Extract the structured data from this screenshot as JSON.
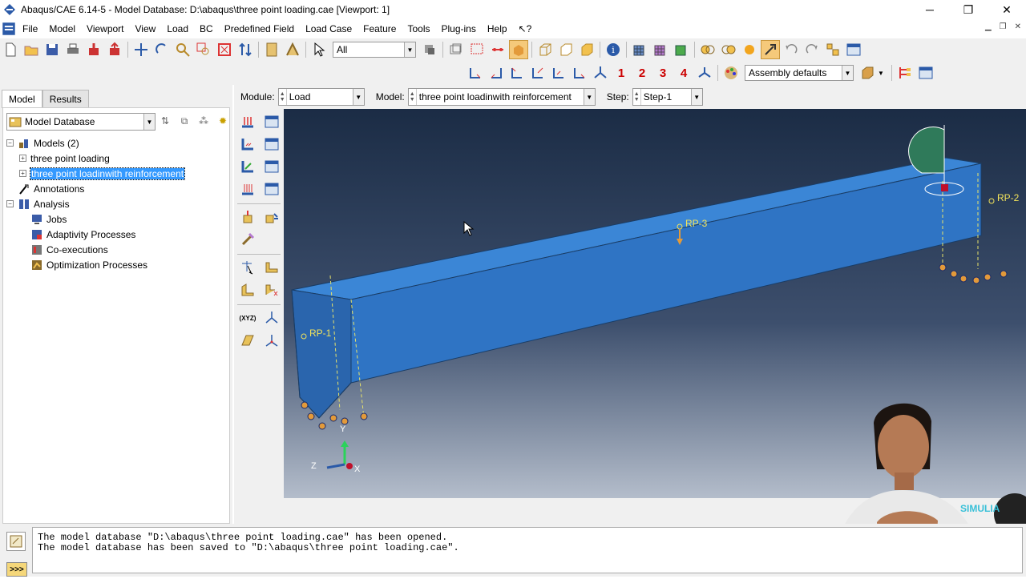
{
  "window": {
    "title": "Abaqus/CAE 6.14-5 - Model Database: D:\\abaqus\\three point loading.cae [Viewport: 1]",
    "minimize": "─",
    "restore": "❐",
    "close": "✕"
  },
  "menu": [
    "File",
    "Model",
    "Viewport",
    "View",
    "Load",
    "BC",
    "Predefined Field",
    "Load Case",
    "Feature",
    "Tools",
    "Plug-ins",
    "Help",
    "↖?"
  ],
  "toolbar": {
    "selection_filter": "All",
    "view_numbers": [
      "1",
      "2",
      "3",
      "4"
    ],
    "render_style": "Assembly defaults"
  },
  "left_panel": {
    "tabs": [
      "Model",
      "Results"
    ],
    "database_select": "Model Database",
    "tree": {
      "models": "Models (2)",
      "model1": "three point loading",
      "model2": "three point loadinwith reinforcement",
      "annotations": "Annotations",
      "analysis": "Analysis",
      "jobs": "Jobs",
      "adaptivity": "Adaptivity Processes",
      "coexecutions": "Co-executions",
      "optimization": "Optimization Processes"
    }
  },
  "context_bar": {
    "module_label": "Module:",
    "module_value": "Load",
    "model_label": "Model:",
    "model_value": "three point loadinwith reinforcement",
    "step_label": "Step:",
    "step_value": "Step-1"
  },
  "viewport": {
    "rp1": "RP-1",
    "rp2": "RP-2",
    "rp3": "RP-3",
    "triad_x": "X",
    "triad_y": "Y",
    "triad_z": "Z",
    "logo": "SIMULIA",
    "colors": {
      "beam_top": "#3b86d6",
      "beam_front": "#2f74c4",
      "beam_side": "#2a65ad",
      "label": "#f2e35a"
    }
  },
  "messages": [
    "The model database \"D:\\abaqus\\three point loading.cae\" has been opened.",
    "The model database has been saved to \"D:\\abaqus\\three point loading.cae\"."
  ],
  "command_button": ">>>"
}
